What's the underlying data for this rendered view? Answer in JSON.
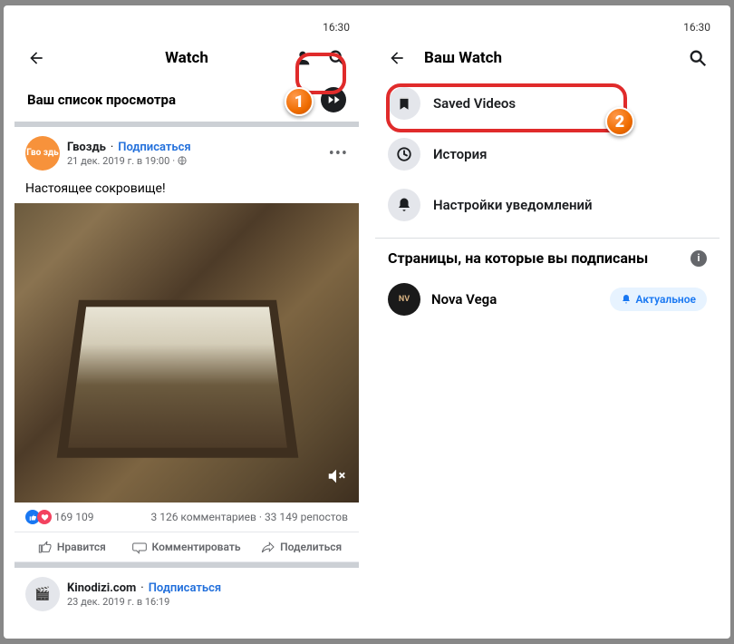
{
  "status": {
    "time": "16:30"
  },
  "left": {
    "header_title": "Watch",
    "sub_title": "Ваш список просмотра",
    "post": {
      "avatar_text": "Гво\nздь",
      "name": "Гвоздь",
      "subscribe": "Подписаться",
      "time": "21 дек. 2019 г. в 19:00",
      "text": "Настоящее сокровище!",
      "likes": "169 109",
      "comments": "3 126 комментариев",
      "shares": "33 149 репостов"
    },
    "actions": {
      "like": "Нравится",
      "comment": "Комментировать",
      "share": "Поделиться"
    },
    "next_post": {
      "name": "Kinodizi.com",
      "subscribe": "Подписаться",
      "time": "23 дек. 2019 г. в 16:19"
    }
  },
  "right": {
    "header_title": "Ваш Watch",
    "menu": {
      "saved": "Saved Videos",
      "history": "История",
      "notifications": "Настройки уведомлений"
    },
    "section_title": "Страницы, на которые вы подписаны",
    "page": {
      "avatar_text": "NV",
      "name": "Nova Vega",
      "chip": "Актуальное"
    }
  },
  "callouts": {
    "one": "1",
    "two": "2"
  }
}
